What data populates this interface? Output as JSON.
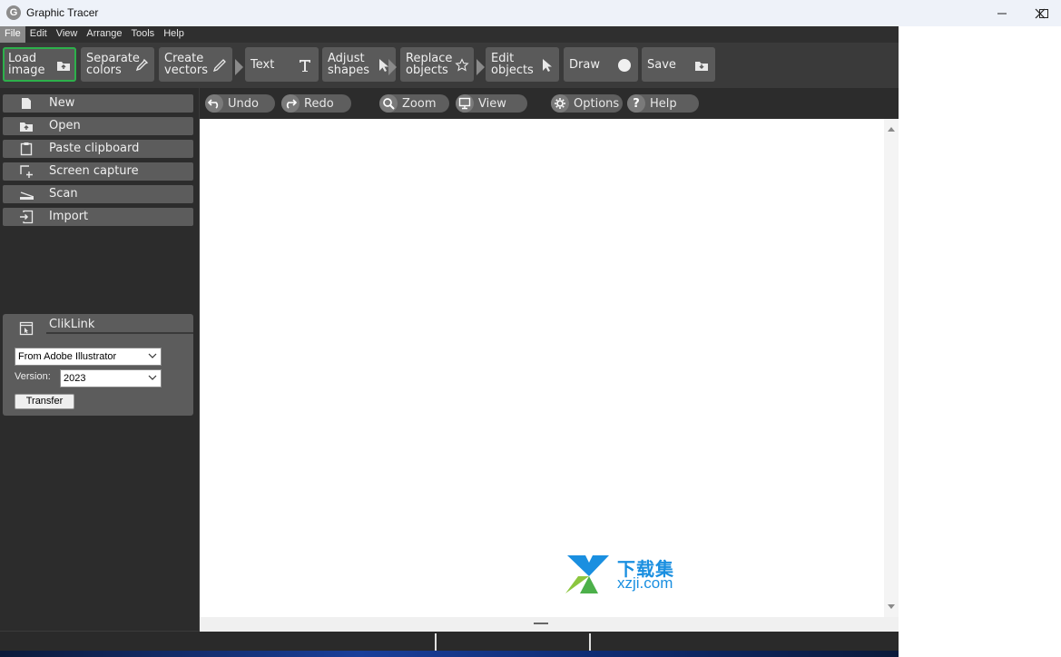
{
  "window": {
    "title": "Graphic Tracer",
    "app_icon_letter": "G"
  },
  "menu": [
    "File",
    "Edit",
    "View",
    "Arrange",
    "Tools",
    "Help"
  ],
  "toolbar": {
    "load": "Load\nimage",
    "separate": "Separate\ncolors",
    "create": "Create\nvectors",
    "text": "Text",
    "adjust": "Adjust\nshapes",
    "replace": "Replace\nobjects",
    "edit": "Edit\nobjects",
    "draw": "Draw",
    "save": "Save"
  },
  "subtoolbar": {
    "undo": "Undo",
    "redo": "Redo",
    "zoom": "Zoom",
    "view": "View",
    "options": "Options",
    "help": "Help"
  },
  "sidebar": {
    "items": [
      {
        "label": "New",
        "icon": "document-icon"
      },
      {
        "label": "Open",
        "icon": "open-folder-icon"
      },
      {
        "label": "Paste clipboard",
        "icon": "clipboard-icon"
      },
      {
        "label": "Screen capture",
        "icon": "screen-capture-icon"
      },
      {
        "label": "Scan",
        "icon": "scanner-icon"
      },
      {
        "label": "Import",
        "icon": "import-icon"
      }
    ]
  },
  "cliklink": {
    "title": "ClikLink",
    "source_selected": "From Adobe Illustrator",
    "version_label": "Version:",
    "version_selected": "2023",
    "transfer_label": "Transfer"
  },
  "watermark": {
    "cn": "下载集",
    "url": "xzji.com"
  },
  "colors": {
    "accent_active": "#2db04b",
    "panel": "#3a3a3a",
    "button": "#5a5a5a"
  }
}
